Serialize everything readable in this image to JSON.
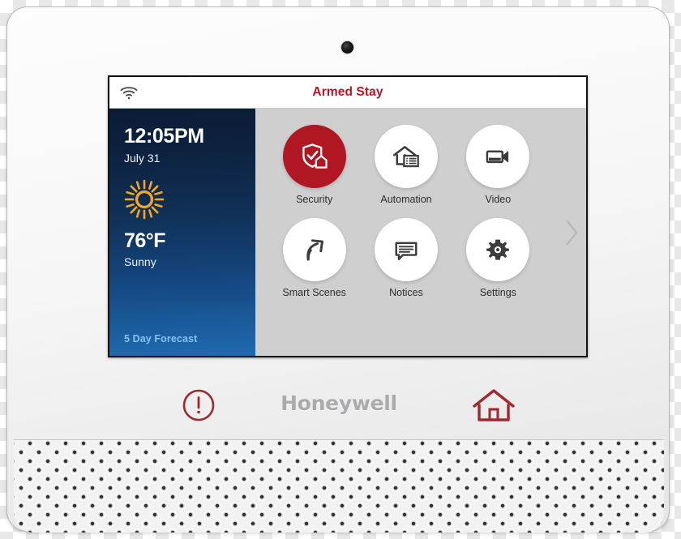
{
  "device": {
    "brand": "Honeywell",
    "camera_icon": "camera-lens",
    "panic_icon": "exclamation-circle-icon",
    "home_icon": "home-icon"
  },
  "screen": {
    "statusbar": {
      "wifi_icon": "wifi-icon",
      "armed_status": "Armed Stay",
      "armed_status_color": "#b01722"
    },
    "weather": {
      "time": "12:05PM",
      "date": "July 31",
      "weather_icon": "sun-icon",
      "temperature": "76°F",
      "condition": "Sunny",
      "forecast_link": "5 Day Forecast",
      "forecast_link_color": "#7fc4ef",
      "gradient_top": "#0b1c35",
      "gradient_bottom": "#1f6bb0"
    },
    "tiles": [
      {
        "label": "Security",
        "icon": "shield-check-home-icon",
        "active": true
      },
      {
        "label": "Automation",
        "icon": "house-list-icon",
        "active": false
      },
      {
        "label": "Video",
        "icon": "video-camera-icon",
        "active": false
      },
      {
        "label": "Smart Scenes",
        "icon": "curved-arrow-icon",
        "active": false
      },
      {
        "label": "Notices",
        "icon": "speech-bubble-icon",
        "active": false
      },
      {
        "label": "Settings",
        "icon": "gear-icon",
        "active": false
      }
    ],
    "next_page_icon": "chevron-right-icon",
    "accent_color": "#b01722",
    "background_color": "#cfcfcf"
  }
}
